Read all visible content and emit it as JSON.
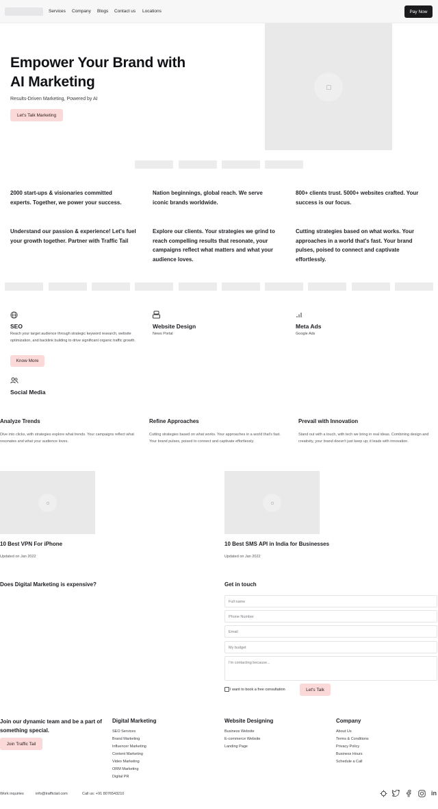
{
  "nav": {
    "links": [
      "Services",
      "Company",
      "Blogs",
      "Contact us",
      "Locations"
    ],
    "cta": "Pay Now"
  },
  "hero": {
    "title_line1": "Empower Your Brand with",
    "title_line2": "AI Marketing",
    "subtitle": "Results-Driven Marketing, Powered by AI",
    "cta": "Let's Talk Marketing"
  },
  "stats": [
    "2000 start-ups & visionaries committed experts. Together, we power your success.",
    "Nation beginnings, global reach. We serve iconic brands worldwide.",
    "800+ clients trust. 5000+ websites crafted. Your success is our focus.",
    "Understand our passion & experience! Let's fuel your growth together. Partner with Traffic Tail",
    "Explore our clients. Your strategies we grind to reach compelling results that resonate, your campaigns reflect what matters and what your audience loves.",
    "Cutting strategies based on what works. Your approaches in a world that's fast. Your brand pulses, poised to connect and captivate effortlessly."
  ],
  "services": {
    "seo": {
      "icon": "globe-icon",
      "title": "SEO",
      "desc": "Reach your target audience through strategic keyword research, website optimization, and backlink building to drive significant organic traffic growth.",
      "cta": "Know More"
    },
    "web": {
      "icon": "layers-icon",
      "title": "Website Design",
      "sub": "News Portal"
    },
    "meta": {
      "icon": "bar-chart-icon",
      "title": "Meta Ads",
      "sub": "Google Ads"
    },
    "social": {
      "icon": "users-icon",
      "title": "Social Media"
    }
  },
  "approach": [
    {
      "title": "Analyze Trends",
      "text": "Dive into clicks, with strategies explore what trends. Your campaigns reflect what resonates and what your audience loves."
    },
    {
      "title": "Refine Approaches",
      "text": "Cutting strategies based on what works. Your approaches in a world that's fast. Your brand pulses, poised to connect and captivate effortlessly."
    },
    {
      "title": "Prevail with Innovation",
      "text": "Stand out with a touch, with tech we bring in real ideas. Combining design and creativity, your brand doesn't just keep up; it leads with innovation."
    }
  ],
  "blogs": [
    {
      "title": "10 Best VPN For iPhone",
      "date": "Updated on Jan 2022"
    },
    {
      "title": "10 Best SMS API in India for Businesses",
      "date": "Updated on Jan 2022"
    }
  ],
  "faq": {
    "question": "Does Digital Marketing is expensive?"
  },
  "contact": {
    "title": "Get in touch",
    "full_name": "Full name",
    "phone": "Phone Number",
    "email": "Email",
    "budget": "My budget",
    "message": "I'm contacting because...",
    "checkbox_label": "I want to book a free consultation",
    "submit": "Let's Talk"
  },
  "footer": {
    "join_text": "Join our dynamic team and be a part of something special.",
    "join_cta": "Join Traffic Tail",
    "digital_marketing": {
      "title": "Digital Marketing",
      "links": [
        "SEO Services",
        "Brand Marketing",
        "Influencer Marketing",
        "Content Marketing",
        "Video Marketing",
        "ORM Marketing",
        "Digital PR"
      ]
    },
    "website_designing": {
      "title": "Website Designing",
      "links": [
        "Business Website",
        "E-commerce Website",
        "Landing Page"
      ]
    },
    "company": {
      "title": "Company",
      "links": [
        "About Us",
        "Terms & Conditions",
        "Privacy Policy",
        "Business Hours",
        "Schedule a Call"
      ]
    },
    "work_inquiries": "Work inquiries",
    "email": "info@traffictail.com",
    "phone": "Call us: +91 8076543210",
    "socials": [
      "linkedin-icon",
      "instagram-icon",
      "facebook-icon",
      "twitter-icon",
      "compass-icon"
    ]
  }
}
